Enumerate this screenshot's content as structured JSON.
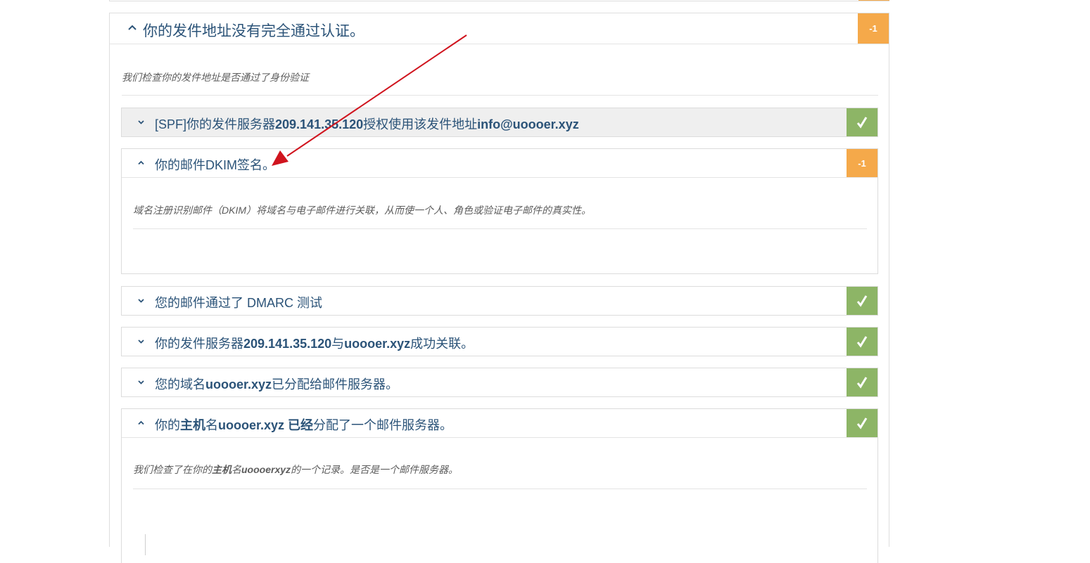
{
  "outer": {
    "title": "你的发件地址没有完全通过认证。",
    "badge": "-1",
    "description": "我们检查你的发件地址是否通过了身份验证"
  },
  "items": [
    {
      "parts": [
        {
          "text": "[SPF]你的发件服务器",
          "bold": false
        },
        {
          "text": "209.141.35.120",
          "bold": true
        },
        {
          "text": "授权使用该发件地址",
          "bold": false
        },
        {
          "text": "info@uoooer.xyz",
          "bold": true
        }
      ],
      "status": "pass"
    },
    {
      "parts": [
        {
          "text": "你的邮件DKIM签名。",
          "bold": false
        }
      ],
      "badge": "-1",
      "status": "warn",
      "description": "域名注册识别邮件（DKIM）将域名与电子邮件进行关联，从而使一个人、角色或验证电子邮件的真实性。"
    },
    {
      "parts": [
        {
          "text": "您的邮件通过了 DMARC 测试",
          "bold": false
        }
      ],
      "status": "pass"
    },
    {
      "parts": [
        {
          "text": "你的发件服务器",
          "bold": false
        },
        {
          "text": "209.141.35.120",
          "bold": true
        },
        {
          "text": "与",
          "bold": false
        },
        {
          "text": "uoooer.xyz",
          "bold": true
        },
        {
          "text": "成功关联。",
          "bold": false
        }
      ],
      "status": "pass"
    },
    {
      "parts": [
        {
          "text": "您的域名",
          "bold": false
        },
        {
          "text": "uoooer.xyz",
          "bold": true
        },
        {
          "text": "已分配给邮件服务器。",
          "bold": false
        }
      ],
      "status": "pass"
    },
    {
      "parts": [
        {
          "text": "你的",
          "bold": false
        },
        {
          "text": "主机",
          "bold": true
        },
        {
          "text": "名",
          "bold": false
        },
        {
          "text": "uoooer.xyz 已经",
          "bold": true
        },
        {
          "text": "分配了一个邮件服务器。",
          "bold": false
        }
      ],
      "status": "pass",
      "description_parts": [
        {
          "text": "我们检查了在你的",
          "bold": false
        },
        {
          "text": "主机",
          "bold": true
        },
        {
          "text": "名",
          "bold": false
        },
        {
          "text": "uoooerxyz",
          "bold": true
        },
        {
          "text": "的一个记录。是否是一个邮件服务器。",
          "bold": false
        }
      ]
    }
  ],
  "colors": {
    "warn": "#f5a94a",
    "pass": "#8db566",
    "title": "#2b5378",
    "arrow": "#d0141e"
  },
  "icons": {
    "expanded": "chevron-up-icon",
    "collapsed": "chevron-down-icon",
    "pass": "check-icon"
  }
}
